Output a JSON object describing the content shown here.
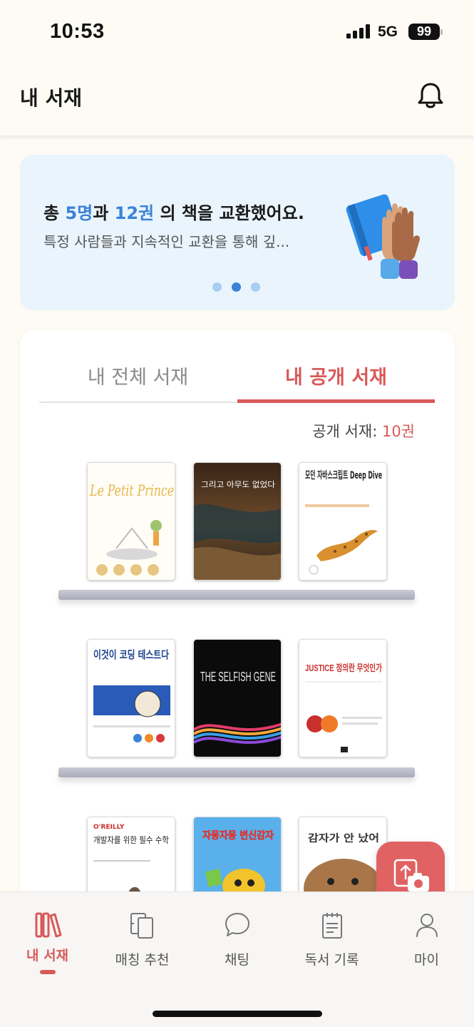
{
  "status_bar": {
    "time": "10:53",
    "network": "5G",
    "battery": "99"
  },
  "header": {
    "title": "내 서재"
  },
  "banner": {
    "headline_prefix": "총 ",
    "people_count": "5명",
    "headline_mid": "과 ",
    "book_count": "12권",
    "headline_suffix": " 의 책을 교환했어요.",
    "subtext": "특정 사람들과 지속적인 교환을 통해 깊...",
    "page_index": 2,
    "page_total": 3,
    "accent_color": "#3b82d6"
  },
  "tabs": [
    {
      "label": "내 전체 서재",
      "active": false
    },
    {
      "label": "내 공개 서재",
      "active": true
    }
  ],
  "shelf": {
    "count_label": "공개 서재: ",
    "count_value": "10권",
    "books": [
      {
        "title_text": "Le Petit Prince",
        "cover": "white"
      },
      {
        "title_text": "그리고 아무도 없었다",
        "cover": "photo"
      },
      {
        "title_text": "모던 자바스크립트 Deep Dive",
        "cover": "white"
      },
      {
        "title_text": "이것이 코딩 테스트다",
        "cover": "white"
      },
      {
        "title_text": "THE SELFISH GENE",
        "cover": "black"
      },
      {
        "title_text": "JUSTICE 정의란 무엇인가",
        "cover": "white"
      },
      {
        "title_text": "개발자를 위한 필수 수학",
        "cover": "white"
      },
      {
        "title_text": "자몽자몽 변신감자",
        "cover": "blue"
      },
      {
        "title_text": "감자가 안 났어",
        "cover": "white"
      }
    ]
  },
  "bottom_nav": [
    {
      "label": "내 서재",
      "icon": "books-icon",
      "active": true
    },
    {
      "label": "매칭 추천",
      "icon": "match-books-icon",
      "active": false
    },
    {
      "label": "채팅",
      "icon": "chat-icon",
      "active": false
    },
    {
      "label": "독서 기록",
      "icon": "notepad-icon",
      "active": false
    },
    {
      "label": "마이",
      "icon": "person-icon",
      "active": false
    }
  ],
  "colors": {
    "brand": "#d85a5a",
    "background": "#fdfbf4",
    "banner_bg": "#e9f4fd"
  }
}
